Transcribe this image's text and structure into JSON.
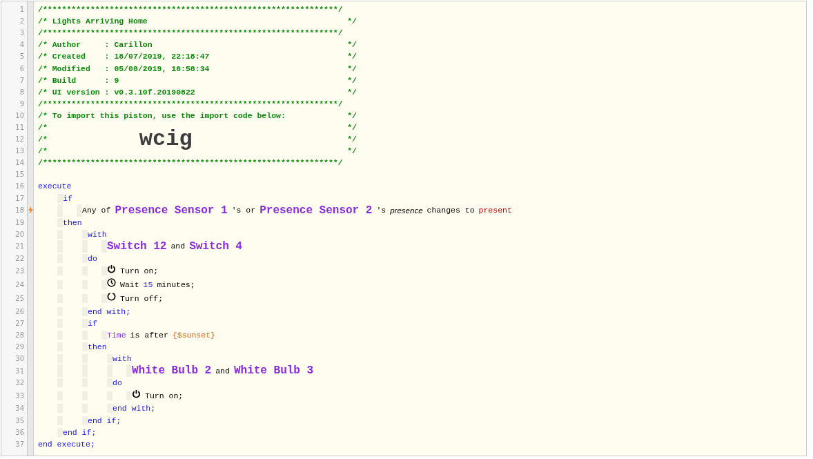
{
  "lines": [
    {
      "number": "1",
      "kind": "comment",
      "text": "/**************************************************************/"
    },
    {
      "number": "2",
      "kind": "comment",
      "text": "/* Lights Arriving Home",
      "close": "*/"
    },
    {
      "number": "3",
      "kind": "comment",
      "text": "/**************************************************************/"
    },
    {
      "number": "4",
      "kind": "comment",
      "text": "/* Author     : Carillon",
      "close": "*/"
    },
    {
      "number": "5",
      "kind": "comment",
      "text": "/* Created    : 18/07/2019, 22:18:47",
      "close": "*/"
    },
    {
      "number": "6",
      "kind": "comment",
      "text": "/* Modified   : 05/08/2019, 16:58:34",
      "close": "*/"
    },
    {
      "number": "7",
      "kind": "comment",
      "text": "/* Build      : 9",
      "close": "*/"
    },
    {
      "number": "8",
      "kind": "comment",
      "text": "/* UI version : v0.3.10f.20190822",
      "close": "*/"
    },
    {
      "number": "9",
      "kind": "comment",
      "text": "/**************************************************************/"
    },
    {
      "number": "10",
      "kind": "comment",
      "text": "/* To import this piston, use the import code below:",
      "close": "*/"
    },
    {
      "number": "11",
      "kind": "comment",
      "text": "/*",
      "close": "*/"
    },
    {
      "number": "12",
      "kind": "import",
      "text": "/*",
      "code": "wcig",
      "close": "*/"
    },
    {
      "number": "13",
      "kind": "comment",
      "text": "/*",
      "close": "*/"
    },
    {
      "number": "14",
      "kind": "comment",
      "text": "/**************************************************************/"
    },
    {
      "number": "15",
      "kind": "blank"
    },
    {
      "number": "16",
      "kind": "code",
      "tokens": [
        {
          "kind": "keyword",
          "text": "execute"
        }
      ],
      "children": [
        {
          "number": "17",
          "kind": "code",
          "tokens": [
            {
              "kind": "keyword",
              "text": "if"
            }
          ],
          "children": [
            {
              "number": "18",
              "kind": "code",
              "trigger": true,
              "tokens": [
                {
                  "kind": "text",
                  "text": "Any of"
                },
                {
                  "kind": "device",
                  "text": "Presence Sensor 1"
                },
                {
                  "kind": "text",
                  "text": "'s or"
                },
                {
                  "kind": "device",
                  "text": "Presence Sensor 2"
                },
                {
                  "kind": "text",
                  "text": "'s"
                },
                {
                  "kind": "italic",
                  "text": "presence"
                },
                {
                  "kind": "text",
                  "text": "changes to"
                },
                {
                  "kind": "value",
                  "text": "present"
                }
              ]
            }
          ]
        },
        {
          "number": "19",
          "kind": "code",
          "tokens": [
            {
              "kind": "keyword",
              "text": "then"
            }
          ],
          "children": [
            {
              "number": "20",
              "kind": "code",
              "tokens": [
                {
                  "kind": "keyword",
                  "text": "with"
                }
              ],
              "children": [
                {
                  "number": "21",
                  "kind": "code",
                  "tokens": [
                    {
                      "kind": "device",
                      "text": "Switch 12"
                    },
                    {
                      "kind": "text",
                      "text": "and"
                    },
                    {
                      "kind": "device",
                      "text": "Switch 4"
                    }
                  ]
                }
              ]
            },
            {
              "number": "22",
              "kind": "code",
              "tokens": [
                {
                  "kind": "keyword",
                  "text": "do"
                }
              ],
              "children": [
                {
                  "number": "23",
                  "kind": "turn_on",
                  "tokens": [
                    {
                      "kind": "text",
                      "text": "Turn on;"
                    }
                  ]
                },
                {
                  "number": "24",
                  "kind": "wait",
                  "tokens": [
                    {
                      "kind": "text",
                      "text": "Wait"
                    },
                    {
                      "kind": "number",
                      "text": "15"
                    },
                    {
                      "kind": "text",
                      "text": "minutes;"
                    }
                  ]
                },
                {
                  "number": "25",
                  "kind": "turn_off",
                  "tokens": [
                    {
                      "kind": "text",
                      "text": "Turn off;"
                    }
                  ]
                }
              ]
            },
            {
              "number": "26",
              "kind": "code",
              "tokens": [
                {
                  "kind": "keyword",
                  "text": "end with;"
                }
              ]
            },
            {
              "number": "27",
              "kind": "code",
              "tokens": [
                {
                  "kind": "keyword",
                  "text": "if"
                }
              ],
              "children": [
                {
                  "number": "28",
                  "kind": "code",
                  "tokens": [
                    {
                      "kind": "attribute",
                      "text": "Time"
                    },
                    {
                      "kind": "text",
                      "text": "is after"
                    },
                    {
                      "kind": "variable",
                      "text": "{$sunset}"
                    }
                  ]
                }
              ]
            },
            {
              "number": "29",
              "kind": "code",
              "tokens": [
                {
                  "kind": "keyword",
                  "text": "then"
                }
              ],
              "children": [
                {
                  "number": "30",
                  "kind": "code",
                  "tokens": [
                    {
                      "kind": "keyword",
                      "text": "with"
                    }
                  ],
                  "children": [
                    {
                      "number": "31",
                      "kind": "code",
                      "tokens": [
                        {
                          "kind": "device",
                          "text": "White Bulb 2"
                        },
                        {
                          "kind": "text",
                          "text": "and"
                        },
                        {
                          "kind": "device",
                          "text": "White Bulb 3"
                        }
                      ]
                    }
                  ]
                },
                {
                  "number": "32",
                  "kind": "code",
                  "tokens": [
                    {
                      "kind": "keyword",
                      "text": "do"
                    }
                  ],
                  "children": [
                    {
                      "number": "33",
                      "kind": "turn_on",
                      "tokens": [
                        {
                          "kind": "text",
                          "text": "Turn on;"
                        }
                      ]
                    }
                  ]
                },
                {
                  "number": "34",
                  "kind": "code",
                  "tokens": [
                    {
                      "kind": "keyword",
                      "text": "end with;"
                    }
                  ]
                }
              ]
            },
            {
              "number": "35",
              "kind": "code",
              "tokens": [
                {
                  "kind": "keyword",
                  "text": "end if;"
                }
              ]
            }
          ]
        },
        {
          "number": "36",
          "kind": "code",
          "tokens": [
            {
              "kind": "keyword",
              "text": "end if;"
            }
          ]
        }
      ]
    },
    {
      "number": "37",
      "kind": "code",
      "tokens": [
        {
          "kind": "keyword",
          "text": "end execute;"
        }
      ]
    }
  ]
}
